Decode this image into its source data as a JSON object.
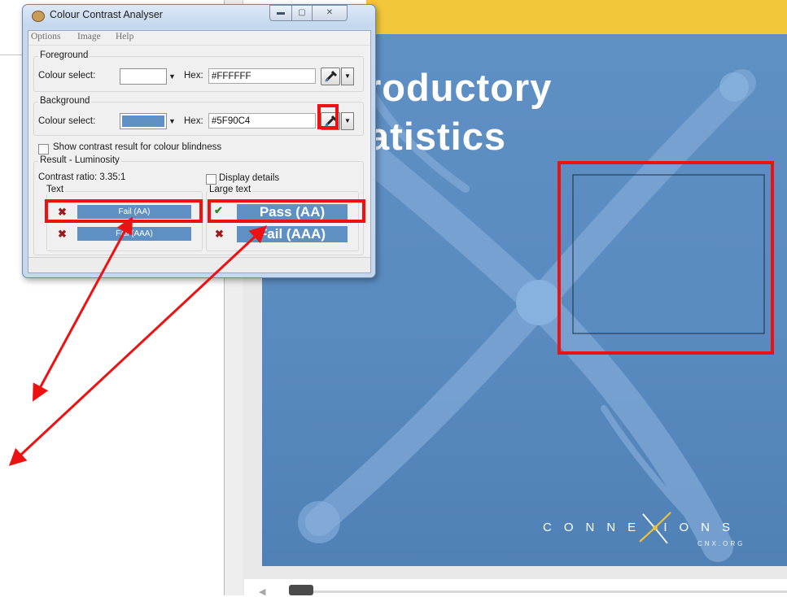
{
  "colors": {
    "cover_bg": "#5F90C4",
    "annotation": "#ee1111",
    "top_strip": "#f2c73a",
    "titlebar": "#c9dbf0"
  },
  "window": {
    "title": "Colour Contrast Analyser",
    "icon": "palette-icon",
    "controls": [
      "minimize-icon",
      "maximize-icon",
      "close-icon"
    ]
  },
  "menu": [
    "Options",
    "Image",
    "Help"
  ],
  "foreground": {
    "legend": "Foreground",
    "colour_label": "Colour select:",
    "hex_label": "Hex:",
    "hex_value": "#FFFFFF",
    "swatch": "#FFFFFF",
    "picker_icon": "eyedropper-icon"
  },
  "background": {
    "legend": "Background",
    "colour_label": "Colour select:",
    "hex_label": "Hex:",
    "hex_value": "#5F90C4",
    "swatch": "#5F90C4",
    "picker_icon": "eyedropper-icon"
  },
  "options": {
    "colour_blindness_label": "Show contrast result for colour blindness",
    "colour_blindness_checked": false
  },
  "result": {
    "legend": "Result - Luminosity",
    "contrast_ratio": "Contrast ratio: 3.35:1",
    "display_details_label": "Display details",
    "display_details_checked": false,
    "text": {
      "legend": "Text",
      "aa": {
        "label": "Fail (AA)",
        "status": "fail"
      },
      "aaa": {
        "label": "Fail (AAA)",
        "status": "fail"
      }
    },
    "large_text": {
      "legend": "Large text",
      "aa": {
        "label": "Pass (AA)",
        "status": "pass"
      },
      "aaa": {
        "label": "Fail (AAA)",
        "status": "fail"
      }
    }
  },
  "document": {
    "title_line1": "roductory",
    "title_line2": "atistics",
    "brand": "CONNE IONS",
    "brand_sub": "CNX.ORG"
  }
}
